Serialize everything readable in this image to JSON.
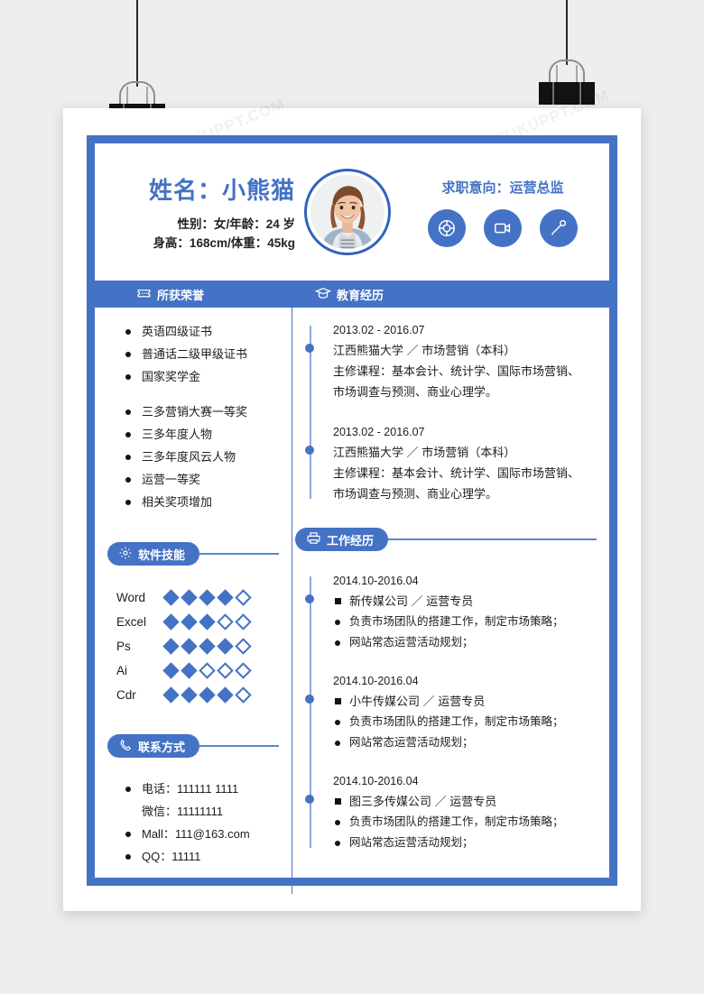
{
  "profile": {
    "name": "姓名：小熊猫",
    "line1": "性别：女/年龄：24 岁",
    "line2": "身高：168cm/体重：45kg",
    "intent": "求职意向：运营总监",
    "intent_icons": [
      "lifebuoy-icon",
      "video-camera-icon",
      "microphone-icon"
    ]
  },
  "sections": {
    "honors": {
      "label": "所获荣誉",
      "icon": "ticket-icon"
    },
    "education": {
      "label": "教育经历",
      "icon": "graduation-cap-icon"
    },
    "skills": {
      "label": "软件技能",
      "icon": "gear-icon"
    },
    "work": {
      "label": "工作经历",
      "icon": "printer-icon"
    },
    "contact": {
      "label": "联系方式",
      "icon": "phone-icon"
    }
  },
  "honors": {
    "group1": [
      "英语四级证书",
      "普通话二级甲级证书",
      "国家奖学金"
    ],
    "group2": [
      "三多营销大赛一等奖",
      "三多年度人物",
      "三多年度风云人物",
      "运营一等奖",
      "相关奖项增加"
    ]
  },
  "education": [
    {
      "date": "2013.02 - 2016.07",
      "org": "江西熊猫大学 ／ 市场营销（本科）",
      "courses_1": "主修课程：基本会计、统计学、国际市场营销、",
      "courses_2": "市场调查与预测、商业心理学。"
    },
    {
      "date": "2013.02 - 2016.07",
      "org": "江西熊猫大学 ／ 市场营销（本科）",
      "courses_1": "主修课程：基本会计、统计学、国际市场营销、",
      "courses_2": "市场调查与预测、商业心理学。"
    }
  ],
  "skills": [
    {
      "name": "Word",
      "rating": 4,
      "max": 5
    },
    {
      "name": "Excel",
      "rating": 3,
      "max": 5
    },
    {
      "name": "Ps",
      "rating": 4,
      "max": 5
    },
    {
      "name": "Ai",
      "rating": 2,
      "max": 5
    },
    {
      "name": "Cdr",
      "rating": 4,
      "max": 5
    }
  ],
  "work": [
    {
      "date": "2014.10-2016.04",
      "org": "新传媒公司 ／ 运营专员",
      "d1": "负责市场团队的搭建工作，制定市场策略；",
      "d2": "网站常态运营活动规划；"
    },
    {
      "date": "2014.10-2016.04",
      "org": "小牛传媒公司 ／ 运营专员",
      "d1": "负责市场团队的搭建工作，制定市场策略；",
      "d2": "网站常态运营活动规划；"
    },
    {
      "date": "2014.10-2016.04",
      "org": "图三多传媒公司 ／ 运营专员",
      "d1": "负责市场团队的搭建工作，制定市场策略；",
      "d2": "网站常态运营活动规划；"
    }
  ],
  "contact": [
    {
      "text": "电话：111111 1111",
      "bullet": true
    },
    {
      "text": "微信：11111111",
      "bullet": false
    },
    {
      "text": "Mall：111@163.com",
      "bullet": true
    },
    {
      "text": "QQ：11111",
      "bullet": true
    }
  ],
  "watermark": "熊猫办公 TUKUPPT.COM",
  "colors": {
    "accent": "#4472c4",
    "accent_dark": "#2f63bd",
    "text": "#1d1d1d"
  }
}
